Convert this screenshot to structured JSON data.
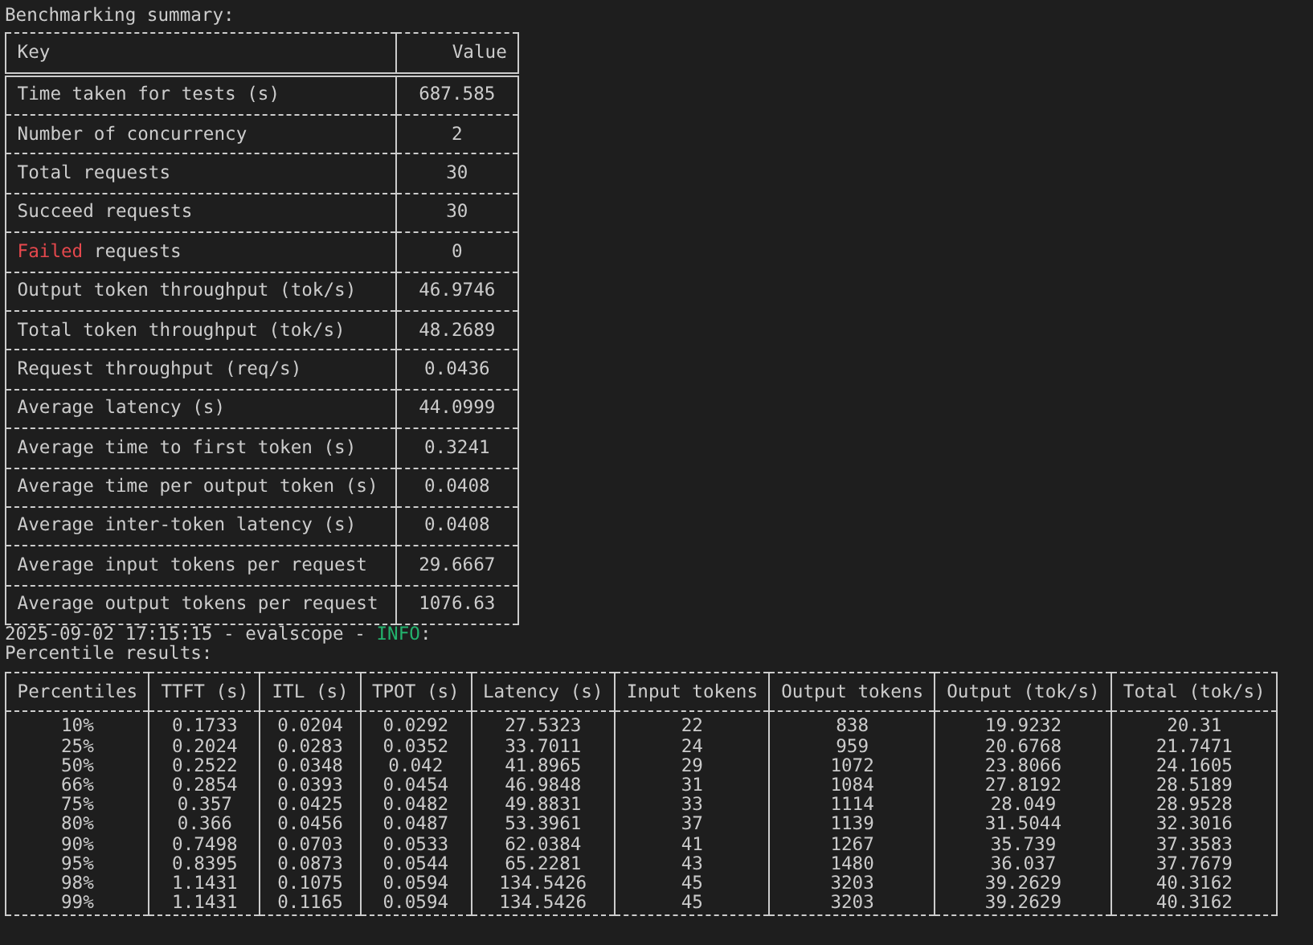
{
  "summary": {
    "title": "Benchmarking summary:",
    "columns": [
      "Key",
      "Value"
    ],
    "rows": [
      {
        "key": [
          {
            "text": "Time taken for tests (s)"
          }
        ],
        "value": "687.585"
      },
      {
        "key": [
          {
            "text": "Number of concurrency"
          }
        ],
        "value": "2"
      },
      {
        "key": [
          {
            "text": "Total requests"
          }
        ],
        "value": "30"
      },
      {
        "key": [
          {
            "text": "Succeed requests"
          }
        ],
        "value": "30"
      },
      {
        "key": [
          {
            "text": "Failed",
            "color": "#e5484d"
          },
          {
            "text": " requests"
          }
        ],
        "value": "0"
      },
      {
        "key": [
          {
            "text": "Output token throughput (tok/s)"
          }
        ],
        "value": "46.9746"
      },
      {
        "key": [
          {
            "text": "Total token throughput (tok/s)"
          }
        ],
        "value": "48.2689"
      },
      {
        "key": [
          {
            "text": "Request throughput (req/s)"
          }
        ],
        "value": "0.0436"
      },
      {
        "key": [
          {
            "text": "Average latency (s)"
          }
        ],
        "value": "44.0999"
      },
      {
        "key": [
          {
            "text": "Average time to first token (s)"
          }
        ],
        "value": "0.3241"
      },
      {
        "key": [
          {
            "text": "Average time per output token (s)"
          }
        ],
        "value": "0.0408"
      },
      {
        "key": [
          {
            "text": "Average inter-token latency (s)"
          }
        ],
        "value": "0.0408"
      },
      {
        "key": [
          {
            "text": "Average input tokens per request"
          }
        ],
        "value": "29.6667"
      },
      {
        "key": [
          {
            "text": "Average output tokens per request"
          }
        ],
        "value": "1076.63"
      }
    ]
  },
  "log_line": [
    {
      "text": "2025-09-02 17:15:15 - evalscope - "
    },
    {
      "text": "INFO",
      "color": "#23b26d"
    },
    {
      "text": ":"
    }
  ],
  "percentiles": {
    "title": "Percentile results:",
    "columns": [
      "Percentiles",
      "TTFT (s)",
      "ITL (s)",
      "TPOT (s)",
      "Latency (s)",
      "Input tokens",
      "Output tokens",
      "Output (tok/s)",
      "Total (tok/s)"
    ],
    "rows": [
      [
        "10%",
        "0.1733",
        "0.0204",
        "0.0292",
        "27.5323",
        "22",
        "838",
        "19.9232",
        "20.31"
      ],
      [
        "25%",
        "0.2024",
        "0.0283",
        "0.0352",
        "33.7011",
        "24",
        "959",
        "20.6768",
        "21.7471"
      ],
      [
        "50%",
        "0.2522",
        "0.0348",
        "0.042",
        "41.8965",
        "29",
        "1072",
        "23.8066",
        "24.1605"
      ],
      [
        "66%",
        "0.2854",
        "0.0393",
        "0.0454",
        "46.9848",
        "31",
        "1084",
        "27.8192",
        "28.5189"
      ],
      [
        "75%",
        "0.357",
        "0.0425",
        "0.0482",
        "49.8831",
        "33",
        "1114",
        "28.049",
        "28.9528"
      ],
      [
        "80%",
        "0.366",
        "0.0456",
        "0.0487",
        "53.3961",
        "37",
        "1139",
        "31.5044",
        "32.3016"
      ],
      [
        "90%",
        "0.7498",
        "0.0703",
        "0.0533",
        "62.0384",
        "41",
        "1267",
        "35.739",
        "37.3583"
      ],
      [
        "95%",
        "0.8395",
        "0.0873",
        "0.0544",
        "65.2281",
        "43",
        "1480",
        "36.037",
        "37.7679"
      ],
      [
        "98%",
        "1.1431",
        "0.1075",
        "0.0594",
        "134.5426",
        "45",
        "3203",
        "39.2629",
        "40.3162"
      ],
      [
        "99%",
        "1.1431",
        "0.1165",
        "0.0594",
        "134.5426",
        "45",
        "3203",
        "39.2629",
        "40.3162"
      ]
    ]
  }
}
